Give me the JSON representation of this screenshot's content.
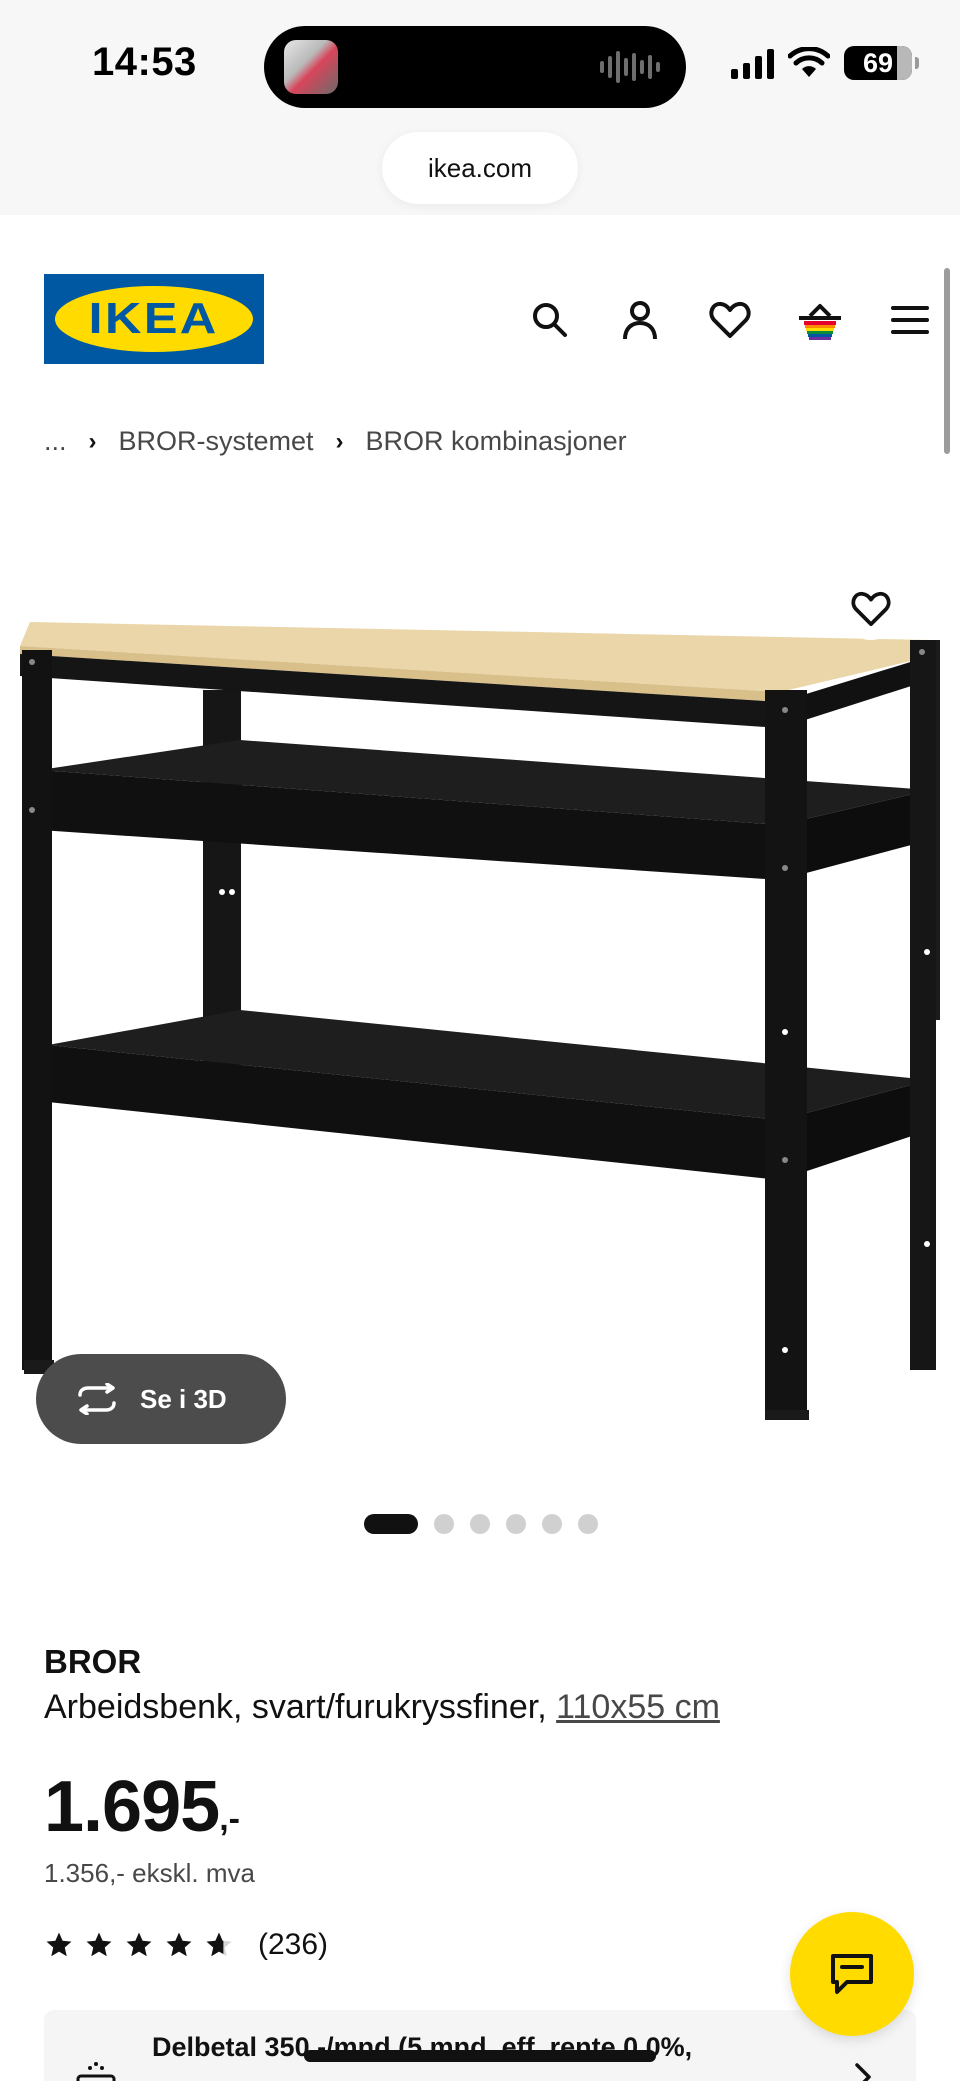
{
  "status_bar": {
    "time": "14:53",
    "battery": "69",
    "url": "ikea.com"
  },
  "header": {
    "logo_text": "IKEA",
    "icons": [
      "search-icon",
      "account-icon",
      "favorites-icon",
      "cart-icon",
      "menu-icon"
    ]
  },
  "breadcrumb": {
    "items": [
      "...",
      "BROR-systemet",
      "BROR kombinasjoner"
    ]
  },
  "gallery": {
    "view_3d_label": "Se i 3D",
    "total_images": 6,
    "active_index": 0
  },
  "product": {
    "name": "BROR",
    "description": "Arbeidsbenk, svart/furukryssfiner,",
    "dimensions": "110x55 cm",
    "price": "1.695",
    "price_suffix": ",-",
    "price_ex_vat": "1.356,- ekskl. mva",
    "rating": 4.6,
    "review_count": "(236)"
  },
  "installment": {
    "text": "Delbetal 350,-/mnd (5 mnd, eff. rente 0,0%,"
  },
  "colors": {
    "ikea_blue": "#0058a3",
    "ikea_yellow": "#ffdb00",
    "button_dark": "#4c4c4c"
  }
}
